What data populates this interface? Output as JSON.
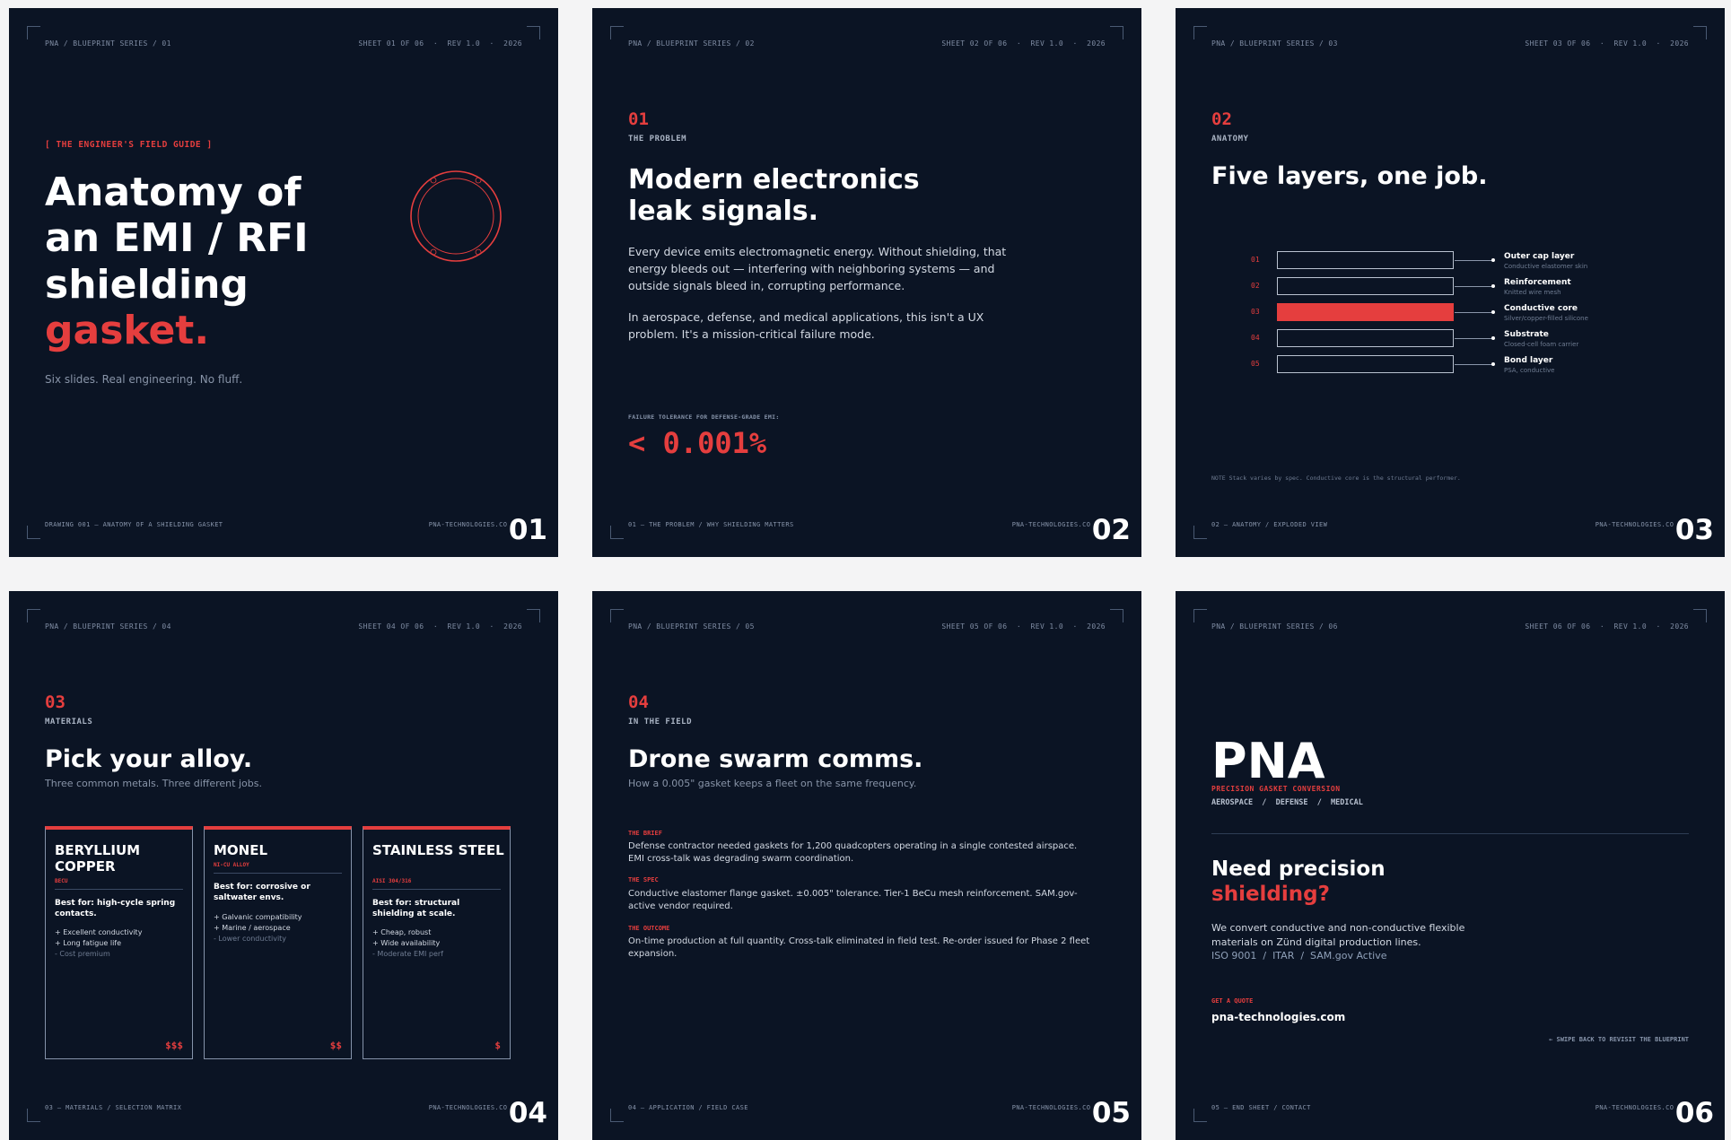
{
  "colors": {
    "background": "#0b1424",
    "accent": "#e53e3e",
    "text": "#ffffff",
    "muted": "#8894a8",
    "canvas": "#f4f4f5"
  },
  "slides": [
    {
      "header_left": "PNA / BLUEPRINT SERIES / 01",
      "header_right": "SHEET 01 OF 06  ·  REV 1.0  ·  2026",
      "kicker": "[ THE ENGINEER'S FIELD GUIDE ]",
      "title_lines": [
        "Anatomy of",
        "an EMI / RFI",
        "shielding"
      ],
      "title_accent": "gasket.",
      "subtitle": "Six slides. Real engineering. No fluff.",
      "footer_left": "DRAWING 001 — ANATOMY OF A SHIELDING GASKET",
      "footer_right": "PNA-TECHNOLOGIES.COM",
      "page_number": "01",
      "icon": "gasket-ring-icon"
    },
    {
      "header_left": "PNA / BLUEPRINT SERIES / 02",
      "header_right": "SHEET 02 OF 06  ·  REV 1.0  ·  2026",
      "section_number": "01",
      "section_label": "THE PROBLEM",
      "title_lines": [
        "Modern electronics",
        "leak signals."
      ],
      "paragraph_1": "Every device emits electromagnetic energy. Without shielding, that energy bleeds out — interfering with neighboring systems — and outside signals bleed in, corrupting performance.",
      "paragraph_2": "In aerospace, defense, and medical applications, this isn't a UX problem. It's a mission-critical failure mode.",
      "stat_label": "FAILURE TOLERANCE FOR DEFENSE-GRADE EMI:",
      "stat_value": "< 0.001%",
      "footer_left": "01 — THE PROBLEM / WHY SHIELDING MATTERS",
      "footer_right": "PNA-TECHNOLOGIES.COM",
      "page_number": "02"
    },
    {
      "header_left": "PNA / BLUEPRINT SERIES / 03",
      "header_right": "SHEET 03 OF 06  ·  REV 1.0  ·  2026",
      "section_number": "02",
      "section_label": "ANATOMY",
      "title": "Five layers, one job.",
      "layers": [
        {
          "num": "01",
          "name": "Outer cap layer",
          "desc": "Conductive elastomer skin",
          "highlight": false
        },
        {
          "num": "02",
          "name": "Reinforcement",
          "desc": "Knitted wire mesh",
          "highlight": false
        },
        {
          "num": "03",
          "name": "Conductive core",
          "desc": "Silver/copper-filled silicone",
          "highlight": true
        },
        {
          "num": "04",
          "name": "Substrate",
          "desc": "Closed-cell foam carrier",
          "highlight": false
        },
        {
          "num": "05",
          "name": "Bond layer",
          "desc": "PSA, conductive",
          "highlight": false
        }
      ],
      "note": "NOTE  Stack varies by spec. Conductive core is the structural performer.",
      "footer_left": "02 — ANATOMY / EXPLODED VIEW",
      "footer_right": "PNA-TECHNOLOGIES.COM",
      "page_number": "03"
    },
    {
      "header_left": "PNA / BLUEPRINT SERIES / 04",
      "header_right": "SHEET 04 OF 06  ·  REV 1.0  ·  2026",
      "section_number": "03",
      "section_label": "MATERIALS",
      "title": "Pick your alloy.",
      "subtitle": "Three common metals. Three different jobs.",
      "cards": [
        {
          "title": "BERYLLIUM COPPER",
          "code": "BECU",
          "best": "Best for: high-cycle spring contacts.",
          "pros": [
            "+ Excellent conductivity",
            "+ Long fatigue life"
          ],
          "cons": [
            "- Cost premium"
          ],
          "price": "$$$"
        },
        {
          "title": "MONEL",
          "code": "NI-CU ALLOY",
          "best": "Best for: corrosive or saltwater envs.",
          "pros": [
            "+ Galvanic compatibility",
            "+ Marine / aerospace"
          ],
          "cons": [
            "- Lower conductivity"
          ],
          "price": "$$"
        },
        {
          "title": "STAINLESS STEEL",
          "code": "AISI 304/316",
          "best": "Best for: structural shielding at scale.",
          "pros": [
            "+ Cheap, robust",
            "+ Wide availability"
          ],
          "cons": [
            "- Moderate EMI perf"
          ],
          "price": "$"
        }
      ],
      "footer_left": "03 — MATERIALS / SELECTION MATRIX",
      "footer_right": "PNA-TECHNOLOGIES.COM",
      "page_number": "04"
    },
    {
      "header_left": "PNA / BLUEPRINT SERIES / 05",
      "header_right": "SHEET 05 OF 06  ·  REV 1.0  ·  2026",
      "section_number": "04",
      "section_label": "IN THE FIELD",
      "title": "Drone swarm comms.",
      "subtitle": "How a 0.005\" gasket keeps a fleet on the same frequency.",
      "blocks": [
        {
          "label": "THE BRIEF",
          "text": "Defense contractor needed gaskets for 1,200 quadcopters operating in a single contested airspace. EMI cross-talk was degrading swarm coordination."
        },
        {
          "label": "THE SPEC",
          "text": "Conductive elastomer flange gasket. ±0.005\" tolerance. Tier-1 BeCu mesh reinforcement. SAM.gov-active vendor required."
        },
        {
          "label": "THE OUTCOME",
          "text": "On-time production at full quantity. Cross-talk eliminated in field test. Re-order issued for Phase 2 fleet expansion."
        }
      ],
      "footer_left": "04 — APPLICATION / FIELD CASE",
      "footer_right": "PNA-TECHNOLOGIES.COM",
      "page_number": "05"
    },
    {
      "header_left": "PNA / BLUEPRINT SERIES / 06",
      "header_right": "SHEET 06 OF 06  ·  REV 1.0  ·  2026",
      "brand": "PNA",
      "brand_tagline": "PRECISION GASKET CONVERSION",
      "markets": "AEROSPACE  /  DEFENSE  /  MEDICAL",
      "cta_title": "Need precision",
      "cta_accent": "shielding?",
      "cta_text": "We convert conductive and non-conductive flexible materials on Zünd digital production lines.",
      "certs": "ISO 9001  /  ITAR  /  SAM.gov Active",
      "quote_label": "GET A QUOTE",
      "website": "pna-technologies.com",
      "swipe_hint": "← SWIPE BACK TO REVISIT THE BLUEPRINT",
      "footer_left": "05 — END SHEET / CONTACT",
      "footer_right": "PNA-TECHNOLOGIES.COM",
      "page_number": "06"
    }
  ]
}
